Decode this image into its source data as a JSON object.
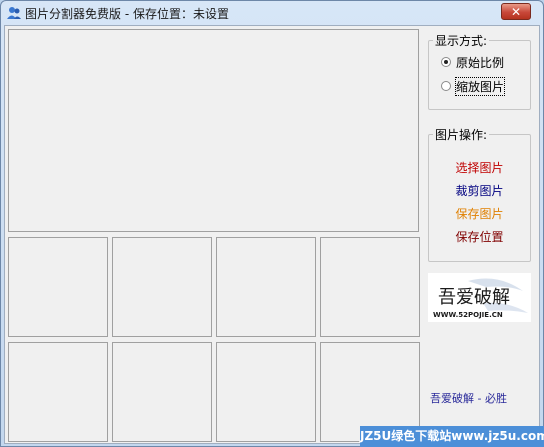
{
  "window": {
    "title": "图片分割器免费版 - 保存位置：未设置",
    "close_label": "✕"
  },
  "display_mode": {
    "title": "显示方式:",
    "options": [
      {
        "label": "原始比例",
        "checked": true
      },
      {
        "label": "缩放图片",
        "checked": false
      }
    ]
  },
  "image_ops": {
    "title": "图片操作:",
    "actions": [
      {
        "label": "选择图片",
        "color": "#c00000"
      },
      {
        "label": "裁剪图片",
        "color": "#000080"
      },
      {
        "label": "保存图片",
        "color": "#e08000"
      },
      {
        "label": "保存位置",
        "color": "#800000"
      }
    ]
  },
  "logo": {
    "text": "吾爱破解",
    "url_text": "WWW.52POJIE.CN"
  },
  "footer": {
    "text": "吾爱破解 - 必胜"
  },
  "watermark": {
    "text": "JZ5U绿色下载站www.jz5u.com"
  }
}
